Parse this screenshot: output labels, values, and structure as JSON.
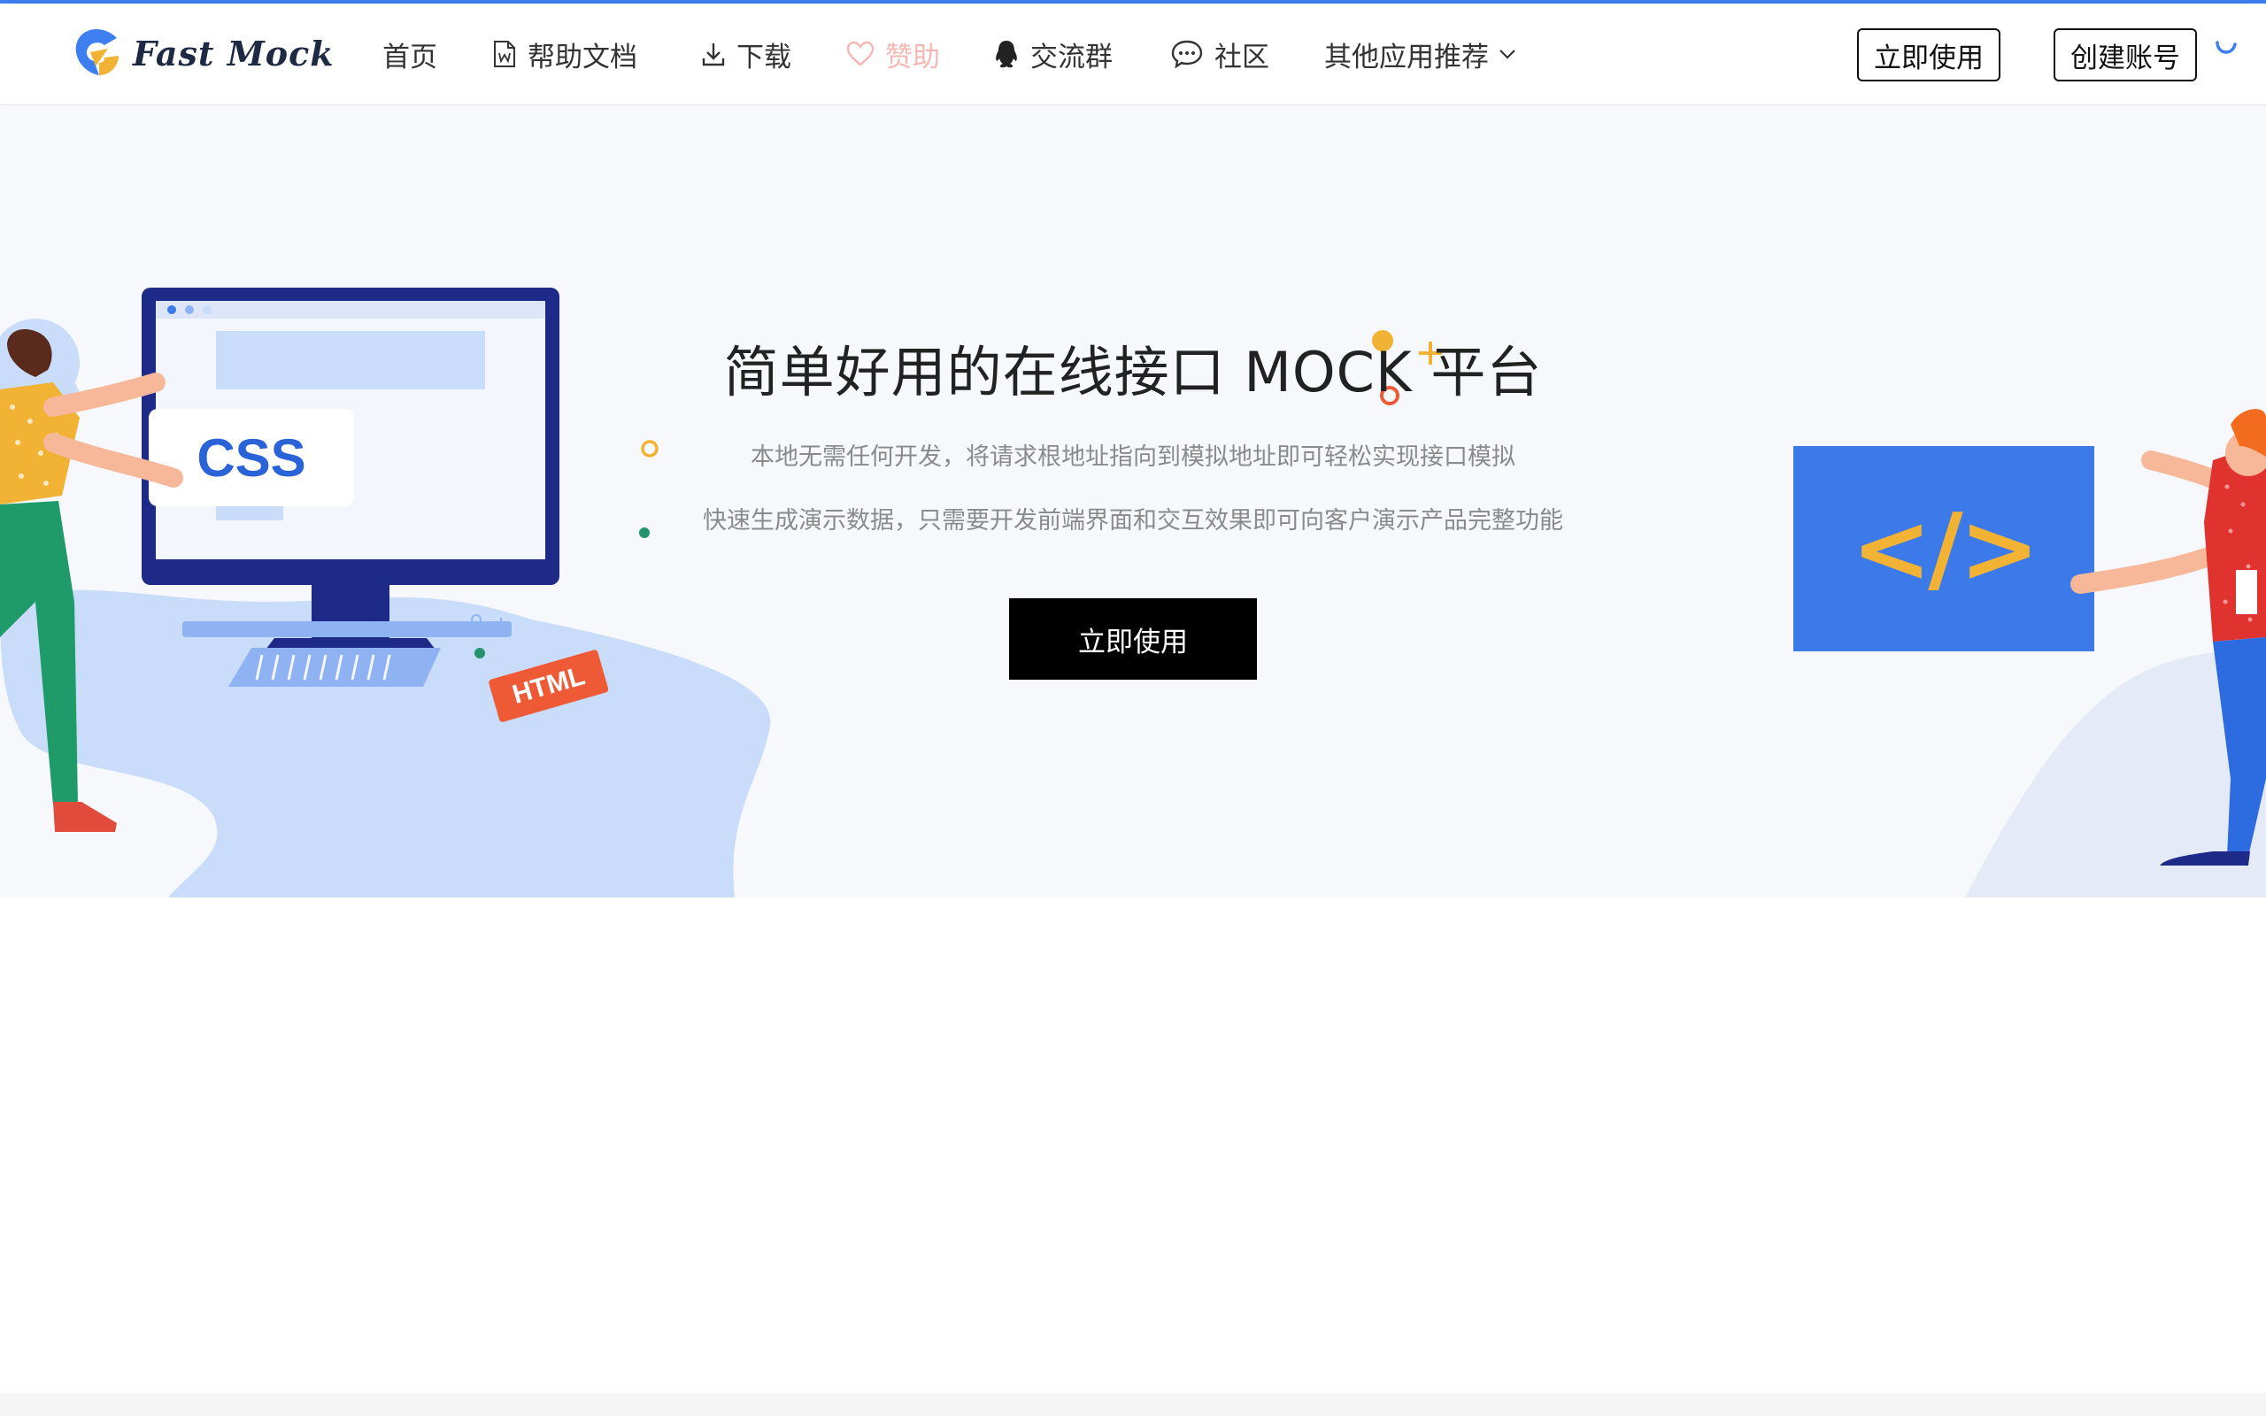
{
  "brand": {
    "name": "Fast Mock"
  },
  "nav": {
    "items": [
      {
        "label": "首页",
        "icon": ""
      },
      {
        "label": "帮助文档",
        "icon": "document-icon"
      },
      {
        "label": "下载",
        "icon": "download-icon"
      },
      {
        "label": "赞助",
        "icon": "heart-icon"
      },
      {
        "label": "交流群",
        "icon": "qq-penguin-icon"
      },
      {
        "label": "社区",
        "icon": "chat-bubble-icon"
      },
      {
        "label": "其他应用推荐",
        "icon": "chevron-down-icon"
      }
    ],
    "use_now": "立即使用",
    "create_account": "创建账号"
  },
  "hero": {
    "title": "简单好用的在线接口 MOCK 平台",
    "subtitle_1": "本地无需任何开发，将请求根地址指向到模拟地址即可轻松实现接口模拟",
    "subtitle_2": "快速生成演示数据，只需要开发前端界面和交互效果即可向客户演示产品完整功能",
    "cta": "立即使用",
    "left_tags": [
      "CSS",
      "HTML"
    ],
    "right_tag": "</>"
  },
  "colors": {
    "accent": "#3d7ff0",
    "cta_bg": "#000000",
    "sponsor": "#f4b7b4",
    "monitor": "#1e2a88",
    "code_card": "#3b7ae8",
    "code_symbol": "#f2b233",
    "html_tag": "#ee5a36"
  }
}
